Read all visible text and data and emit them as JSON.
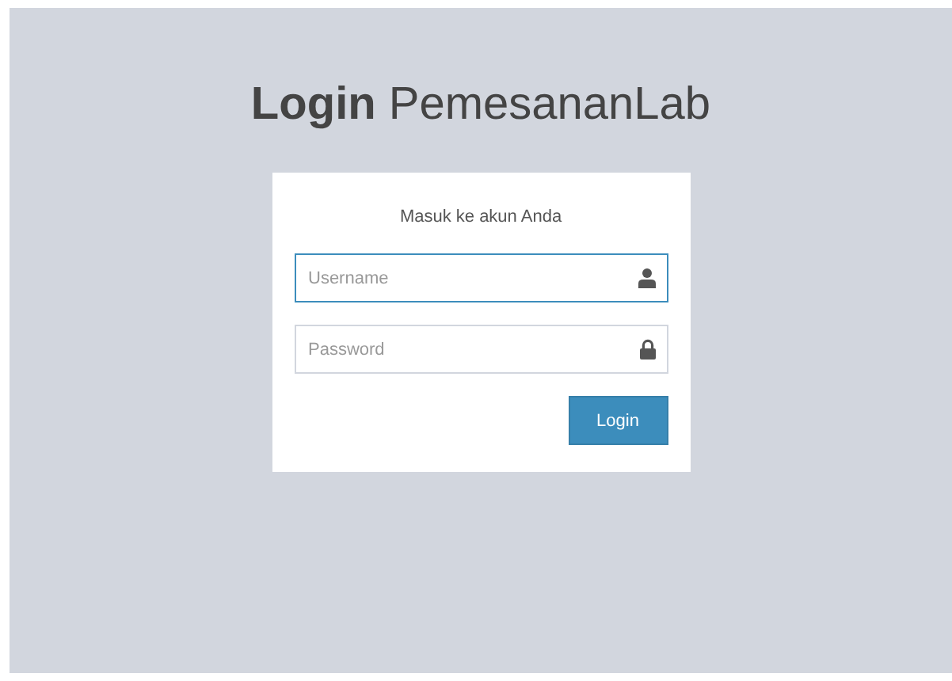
{
  "title": "**Login** PemesananLab",
  "login_box": {
    "message": "Masuk ke akun Anda",
    "fields": [
      {
        "kind": "user",
        "placeholder": "Username",
        "focused": true
      },
      {
        "kind": "lock",
        "placeholder": "Password",
        "focused": false
      }
    ],
    "button": "Login"
  }
}
